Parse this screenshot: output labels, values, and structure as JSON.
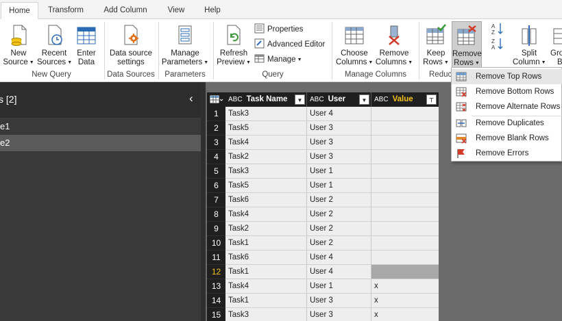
{
  "tabs": [
    {
      "label": "Home",
      "active": true
    },
    {
      "label": "Transform",
      "active": false
    },
    {
      "label": "Add Column",
      "active": false
    },
    {
      "label": "View",
      "active": false
    },
    {
      "label": "Help",
      "active": false
    }
  ],
  "ribbon": {
    "new_source": {
      "line1": "New",
      "line2": "Source"
    },
    "recent_sources": {
      "line1": "Recent",
      "line2": "Sources"
    },
    "enter_data": {
      "line1": "Enter",
      "line2": "Data"
    },
    "data_source_settings": {
      "line1": "Data source",
      "line2": "settings"
    },
    "manage_parameters": {
      "line1": "Manage",
      "line2": "Parameters"
    },
    "refresh_preview": {
      "line1": "Refresh",
      "line2": "Preview"
    },
    "properties": "Properties",
    "advanced_editor": "Advanced Editor",
    "manage": "Manage",
    "choose_columns": {
      "line1": "Choose",
      "line2": "Columns"
    },
    "remove_columns": {
      "line1": "Remove",
      "line2": "Columns"
    },
    "keep_rows": {
      "line1": "Keep",
      "line2": "Rows"
    },
    "remove_rows": {
      "line1": "Remove",
      "line2": "Rows"
    },
    "split_column": {
      "line1": "Split",
      "line2": "Column"
    },
    "group_by": {
      "line1": "Gro",
      "line2": "B"
    },
    "groups": {
      "new_query": "New Query",
      "data_sources": "Data Sources",
      "parameters": "Parameters",
      "query": "Query",
      "manage_columns": "Manage Columns",
      "reduce": "Reduc"
    }
  },
  "queries_pane": {
    "title": "s [2]",
    "items": [
      {
        "label": "e1",
        "selected": false
      },
      {
        "label": "e2",
        "selected": true
      }
    ]
  },
  "table": {
    "columns": [
      {
        "type": "ABC",
        "name": "Task Name"
      },
      {
        "type": "ABC",
        "name": "User"
      },
      {
        "type": "ABC",
        "name": "Value",
        "color": "#f2c314"
      }
    ],
    "rows": [
      {
        "n": "1",
        "task": "Task3",
        "user": "User 4",
        "value": ""
      },
      {
        "n": "2",
        "task": "Task5",
        "user": "User 3",
        "value": ""
      },
      {
        "n": "3",
        "task": "Task4",
        "user": "User 3",
        "value": ""
      },
      {
        "n": "4",
        "task": "Task2",
        "user": "User 3",
        "value": ""
      },
      {
        "n": "5",
        "task": "Task3",
        "user": "User 1",
        "value": ""
      },
      {
        "n": "6",
        "task": "Task5",
        "user": "User 1",
        "value": ""
      },
      {
        "n": "7",
        "task": "Task6",
        "user": "User 2",
        "value": ""
      },
      {
        "n": "8",
        "task": "Task4",
        "user": "User 2",
        "value": ""
      },
      {
        "n": "9",
        "task": "Task2",
        "user": "User 2",
        "value": ""
      },
      {
        "n": "10",
        "task": "Task1",
        "user": "User 2",
        "value": ""
      },
      {
        "n": "11",
        "task": "Task6",
        "user": "User 4",
        "value": ""
      },
      {
        "n": "12",
        "task": "Task1",
        "user": "User 4",
        "value": "",
        "highlight": true
      },
      {
        "n": "13",
        "task": "Task4",
        "user": "User 1",
        "value": "x"
      },
      {
        "n": "14",
        "task": "Task1",
        "user": "User 3",
        "value": "x"
      },
      {
        "n": "15",
        "task": "Task3",
        "user": "User 3",
        "value": "x"
      }
    ]
  },
  "remove_rows_menu": [
    {
      "label": "Remove Top Rows",
      "icon": "remove-top-rows-icon",
      "hover": true
    },
    {
      "label": "Remove Bottom Rows",
      "icon": "remove-bottom-rows-icon"
    },
    {
      "label": "Remove Alternate Rows",
      "icon": "remove-alternate-rows-icon"
    },
    {
      "label": "Remove Duplicates",
      "icon": "remove-duplicates-icon"
    },
    {
      "label": "Remove Blank Rows",
      "icon": "remove-blank-rows-icon"
    },
    {
      "label": "Remove Errors",
      "icon": "remove-errors-icon"
    }
  ],
  "colors": {
    "accent": "#f2c314",
    "ribbon_highlight": "#cfcfcf",
    "dark_pane": "#393939",
    "grid_header": "#1f1f1f"
  }
}
